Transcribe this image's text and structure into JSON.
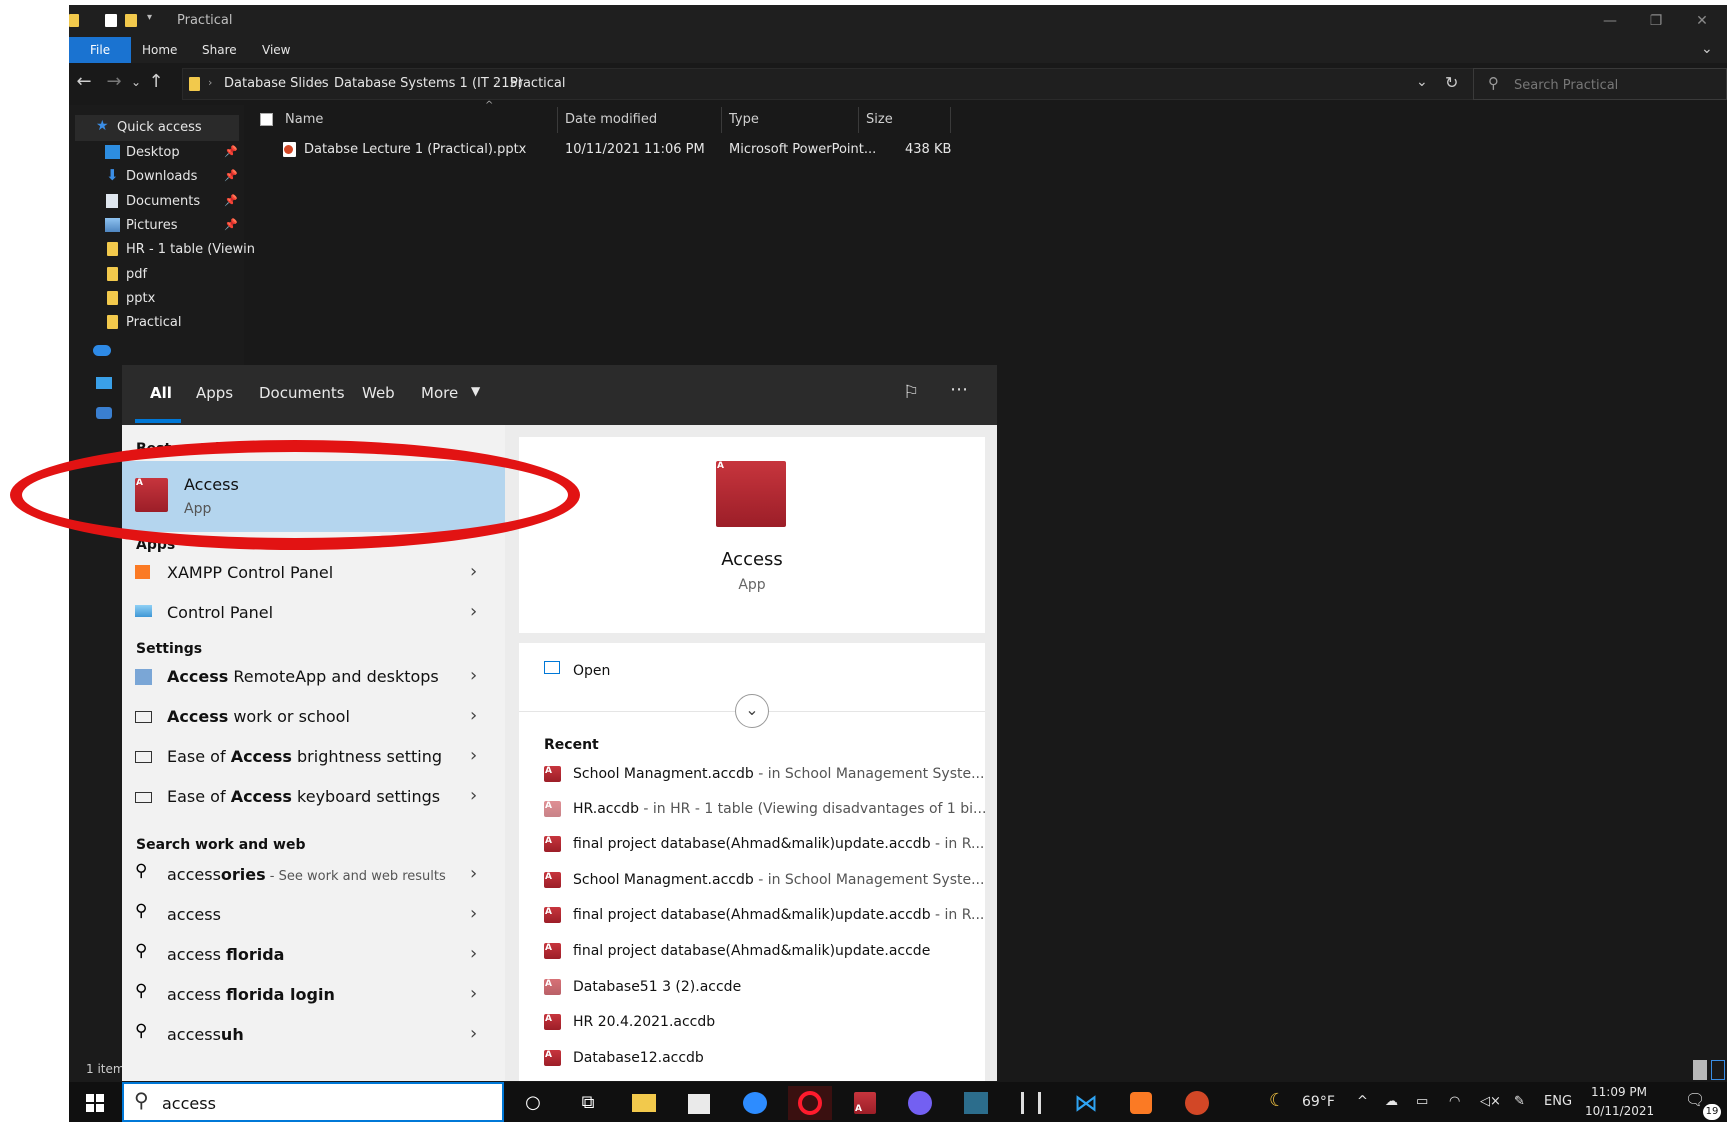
{
  "explorer": {
    "window_title": "Practical",
    "ribbon_tabs": [
      "File",
      "Home",
      "Share",
      "View"
    ],
    "breadcrumb": [
      "Database Slides",
      "Database Systems 1 (IT 215)",
      "Practical"
    ],
    "search_placeholder": "Search Practical",
    "nav_items": [
      {
        "label": "Quick access",
        "icon": "star-icon"
      },
      {
        "label": "Desktop",
        "icon": "desktop-icon",
        "pinned": true
      },
      {
        "label": "Downloads",
        "icon": "download-icon",
        "pinned": true
      },
      {
        "label": "Documents",
        "icon": "documents-icon",
        "pinned": true
      },
      {
        "label": "Pictures",
        "icon": "pictures-icon",
        "pinned": true
      },
      {
        "label": "HR - 1 table (Viewin",
        "icon": "folder-icon"
      },
      {
        "label": "pdf",
        "icon": "folder-icon"
      },
      {
        "label": "pptx",
        "icon": "folder-icon"
      },
      {
        "label": "Practical",
        "icon": "folder-icon"
      }
    ],
    "columns": [
      "Name",
      "Date modified",
      "Type",
      "Size"
    ],
    "files": [
      {
        "name": "Databse Lecture 1 (Practical).pptx",
        "date": "10/11/2021 11:06 PM",
        "type": "Microsoft PowerPoint...",
        "size": "438 KB"
      }
    ],
    "status": "1 item"
  },
  "search_panel": {
    "tabs": [
      "All",
      "Apps",
      "Documents",
      "Web",
      "More"
    ],
    "best_match_heading": "Best match",
    "best_match": {
      "name": "Access",
      "kind": "App"
    },
    "apps_heading": "Apps",
    "apps": [
      "XAMPP Control Panel",
      "Control Panel"
    ],
    "settings_heading": "Settings",
    "settings": [
      {
        "bold": "Access",
        "rest": " RemoteApp and desktops"
      },
      {
        "bold": "Access",
        "rest": " work or school"
      },
      {
        "pre": "Ease of ",
        "bold": "Access",
        "rest": " brightness setting"
      },
      {
        "pre": "Ease of ",
        "bold": "Access",
        "rest": " keyboard settings"
      }
    ],
    "web_heading": "Search work and web",
    "web": [
      {
        "pre": "access",
        "bold": "ories",
        "sub": " - See work and web results"
      },
      {
        "pre": "access",
        "bold": ""
      },
      {
        "pre": "access ",
        "bold": "florida"
      },
      {
        "pre": "access ",
        "bold": "florida login"
      },
      {
        "pre": "access",
        "bold": "uh"
      }
    ],
    "preview": {
      "name": "Access",
      "kind": "App",
      "open_label": "Open",
      "recent_heading": "Recent",
      "recent": [
        {
          "file": "School Managment.accdb",
          "loc": " - in School Management Syste..."
        },
        {
          "file": "HR.accdb",
          "loc": " - in HR - 1 table (Viewing disadvantages of 1 bi..."
        },
        {
          "file": "final project database(Ahmad&malik)update.accdb",
          "loc": " - in R..."
        },
        {
          "file": "School Managment.accdb",
          "loc": " - in School Management Syste..."
        },
        {
          "file": "final project database(Ahmad&malik)update.accdb",
          "loc": " - in R..."
        },
        {
          "file": "final project database(Ahmad&malik)update.accde",
          "loc": ""
        },
        {
          "file": "Database51 3 (2).accde",
          "loc": ""
        },
        {
          "file": "HR 20.4.2021.accdb",
          "loc": ""
        },
        {
          "file": "Database12.accdb",
          "loc": ""
        }
      ]
    }
  },
  "taskbar": {
    "search_value": "access",
    "weather": "69°F",
    "language": "ENG",
    "time": "11:09 PM",
    "date": "10/11/2021",
    "notification_count": "19"
  },
  "colors": {
    "accent": "#0078d7",
    "annotation": "#e21313",
    "selection": "#b4d5ee"
  }
}
